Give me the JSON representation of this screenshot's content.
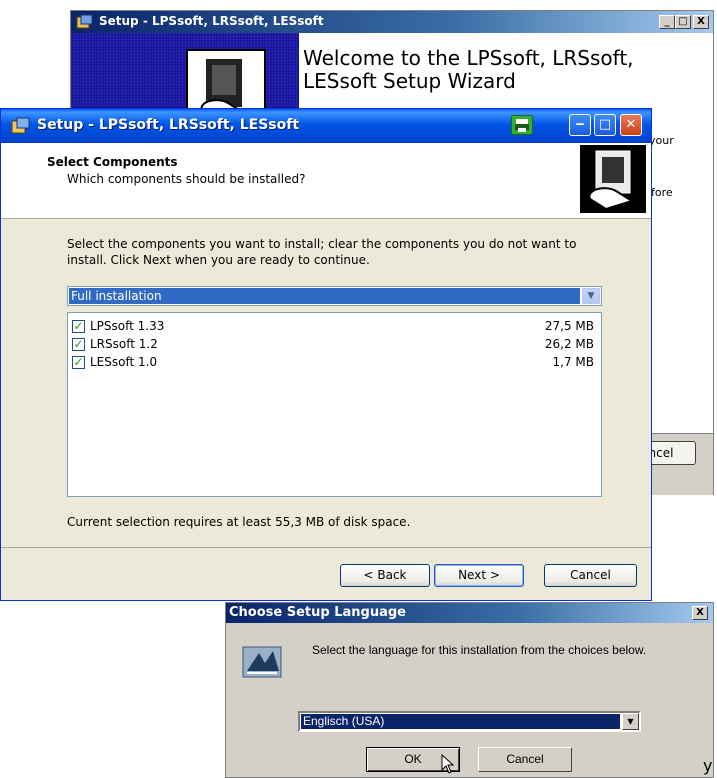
{
  "back_window": {
    "title": "Setup - LPSsoft, LRSsoft, LESsoft",
    "welcome_title": "Welcome to the LPSsoft, LRSsoft, LESsoft Setup Wizard",
    "peek_text_1": "your",
    "peek_text_2": "fore",
    "cancel_peek": "ncel",
    "controls": {
      "minimize": "_",
      "maximize": "□",
      "close": "X"
    }
  },
  "main_window": {
    "title": "Setup - LPSsoft, LRSsoft, LESsoft",
    "header_title": "Select Components",
    "header_subtitle": "Which components should be installed?",
    "instructions": "Select the components you want to install; clear the components you do not want to install. Click Next when you are ready to continue.",
    "install_type": "Full installation",
    "components": [
      {
        "name": "LPSsoft 1.33",
        "size": "27,5 MB",
        "checked": true
      },
      {
        "name": "LRSsoft 1.2",
        "size": "26,2 MB",
        "checked": true
      },
      {
        "name": "LESsoft 1.0",
        "size": "1,7 MB",
        "checked": true
      }
    ],
    "requirement_text": "Current selection requires at least 55,3 MB of disk space.",
    "buttons": {
      "back": "< Back",
      "next": "Next >",
      "cancel": "Cancel"
    }
  },
  "language_dialog": {
    "title": "Choose Setup Language",
    "close": "X",
    "prompt": "Select the language for this installation from the choices below.",
    "selected_language": "Englisch (USA)",
    "buttons": {
      "ok": "OK",
      "cancel": "Cancel"
    }
  },
  "stray_char": "y",
  "colors": {
    "xp_title_blue": "#0055e5",
    "classic_title_blue": "#0a246a",
    "selection_blue": "#316ac5",
    "dialog_gray": "#d4d0c8",
    "xp_face": "#ece9d8"
  },
  "icons": [
    "setup-app-icon",
    "computer-install-icon",
    "printer-icon",
    "minimize-icon",
    "maximize-icon",
    "close-icon",
    "language-setup-icon",
    "mouse-cursor-icon",
    "check-icon",
    "dropdown-arrow-icon"
  ]
}
